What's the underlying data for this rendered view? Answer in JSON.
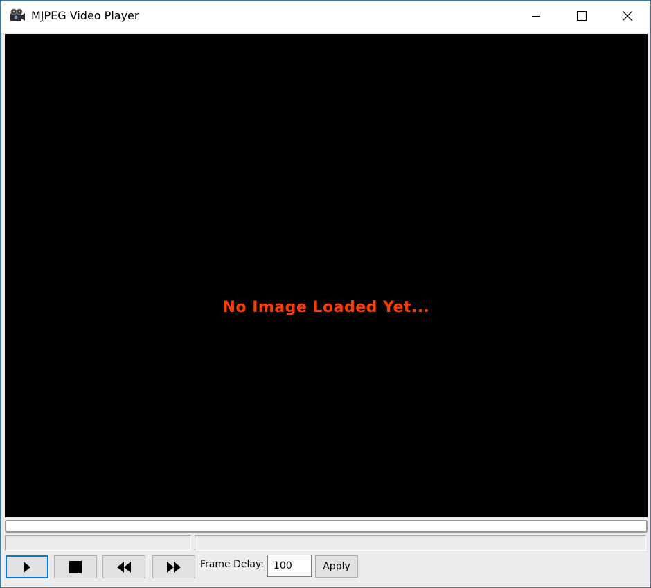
{
  "window": {
    "title": "MJPEG Video Player",
    "icon": "camera-reel-icon"
  },
  "caption_buttons": {
    "minimize_icon": "minimize-icon",
    "maximize_icon": "maximize-icon",
    "close_icon": "close-icon"
  },
  "video": {
    "message": "No Image Loaded Yet...",
    "message_color": "#ff3c00",
    "background_color": "#000000"
  },
  "progress": {
    "value_fraction": 0
  },
  "status": {
    "left_text": "",
    "right_text": ""
  },
  "controls": {
    "play_icon": "play-icon",
    "stop_icon": "stop-icon",
    "rewind_icon": "rewind-icon",
    "fast_forward_icon": "fast-forward-icon",
    "frame_delay_label": "Frame Delay:",
    "frame_delay_value": "100",
    "apply_label": "Apply"
  },
  "colors": {
    "focus_accent": "#0078d7",
    "window_border": "#3c78b4"
  }
}
